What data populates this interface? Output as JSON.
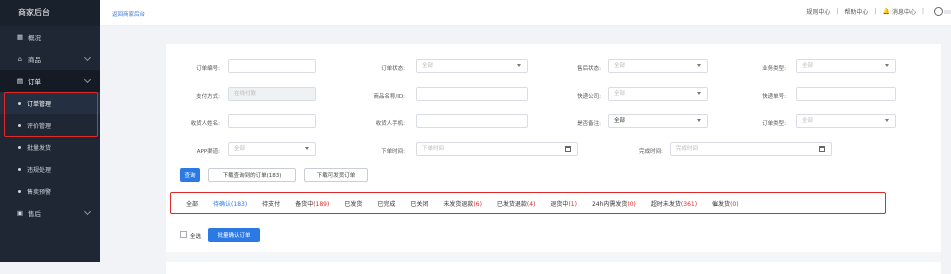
{
  "sidebar": {
    "brand": "商家后台",
    "items": [
      {
        "label": "概况",
        "icon": "grid-icon"
      },
      {
        "label": "商品",
        "icon": "bag-icon",
        "chevron": true
      },
      {
        "label": "订单",
        "icon": "order-icon",
        "chevron": true,
        "active": true
      },
      {
        "label": "订单管理",
        "sub": true,
        "active": true
      },
      {
        "label": "评价管理",
        "sub": true
      },
      {
        "label": "批量发货",
        "sub": true
      },
      {
        "label": "违规处理",
        "sub": true
      },
      {
        "label": "售卖预警",
        "sub": true
      },
      {
        "label": "售后",
        "icon": "aftersale-icon",
        "chevron": true
      }
    ]
  },
  "topbar": {
    "breadcrumb": "返回商家后台",
    "links": [
      "规则中心",
      "帮助中心",
      "消息中心"
    ]
  },
  "filters": {
    "order_no_label": "订单编号:",
    "order_status_label": "订单状态:",
    "order_status_value": "全部",
    "aftersale_status_label": "售后状态:",
    "aftersale_status_value": "全部",
    "business_type_label": "业务类型:",
    "business_type_value": "全部",
    "pay_method_label": "支付方式:",
    "pay_method_value": "在线付款",
    "product_name_label": "商品名称/ID:",
    "express_label": "快递公司:",
    "express_value": "全部",
    "express_no_label": "快递单号:",
    "receiver_name_label": "收货人姓名:",
    "receiver_phone_label": "收货人手机:",
    "remark_label": "是否备注:",
    "remark_value": "全部",
    "order_type_label": "订单类型:",
    "order_type_value": "全部",
    "app_channel_label": "APP渠道:",
    "app_channel_value": "全部",
    "order_time_label": "下单时间:",
    "order_time_placeholder": "下单时间",
    "complete_time_label": "完成时间:",
    "complete_time_placeholder": "完成时间"
  },
  "actions": {
    "search": "查询",
    "download": "下载查询到的订单(183)",
    "download_ship": "下载可发货订单"
  },
  "tabs": [
    {
      "label": "全部",
      "count": ""
    },
    {
      "label": "待确认",
      "count": "(183)",
      "selected": true
    },
    {
      "label": "待支付",
      "count": ""
    },
    {
      "label": "备货中",
      "count": "(189)"
    },
    {
      "label": "已发货",
      "count": ""
    },
    {
      "label": "已完成",
      "count": ""
    },
    {
      "label": "已关闭",
      "count": ""
    },
    {
      "label": "未发货退款",
      "count": "(6)"
    },
    {
      "label": "已发货退款",
      "count": "(4)"
    },
    {
      "label": "退货中",
      "count": "(1)"
    },
    {
      "label": "24h内需发货",
      "count": "(0)"
    },
    {
      "label": "超时未发货",
      "count": "(361)"
    },
    {
      "label": "催发货",
      "count": "(0)"
    }
  ],
  "bulk": {
    "select_all": "全选",
    "batch_confirm": "批量确认订单"
  }
}
